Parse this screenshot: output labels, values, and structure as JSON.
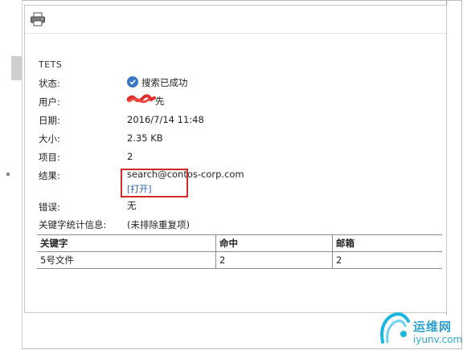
{
  "report": {
    "title": "TETS",
    "fields": [
      {
        "label": "状态:",
        "value": "搜索已成功"
      },
      {
        "label": "用户:",
        "value": "先"
      },
      {
        "label": "日期:",
        "value": "2016/7/14 11:48"
      },
      {
        "label": "大小:",
        "value": "2.35 KB"
      },
      {
        "label": "项目:",
        "value": "2"
      },
      {
        "label": "结果:",
        "value": "search@contos-corp.com"
      },
      {
        "label": "错误:",
        "value": "无"
      },
      {
        "label": "关键字统计信息:",
        "value": "(未排除重复项)"
      }
    ],
    "open_link": "[打开]"
  },
  "stats_table": {
    "headers": [
      "关键字",
      "命中",
      "邮箱"
    ],
    "rows": [
      [
        "5号文件",
        "2",
        "2"
      ]
    ]
  },
  "icons": {
    "print": "printer-icon",
    "status": "check-circle-icon"
  },
  "colors": {
    "highlight": "#d02b2b",
    "link": "#2a5db0",
    "status_icon": "#3a78c8"
  },
  "watermark": {
    "text_top": "运维网",
    "text_bottom": "iyunv.com"
  }
}
